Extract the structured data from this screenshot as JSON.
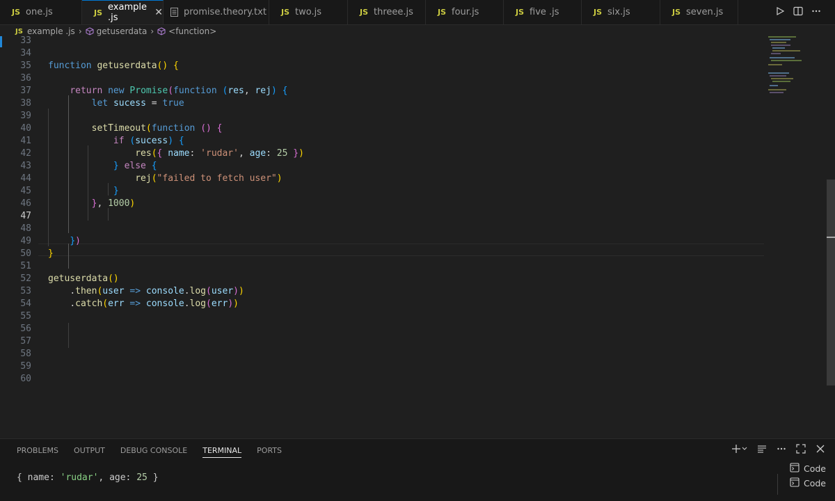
{
  "tabs": [
    {
      "label": "one.js",
      "type": "js",
      "active": false
    },
    {
      "label": "example .js",
      "type": "js",
      "active": true
    },
    {
      "label": "promise.theory.txt",
      "type": "txt",
      "active": false
    },
    {
      "label": "two.js",
      "type": "js",
      "active": false
    },
    {
      "label": "threee.js",
      "type": "js",
      "active": false
    },
    {
      "label": "four.js",
      "type": "js",
      "active": false
    },
    {
      "label": "five .js",
      "type": "js",
      "active": false
    },
    {
      "label": "six.js",
      "type": "js",
      "active": false
    },
    {
      "label": "seven.js",
      "type": "js",
      "active": false
    }
  ],
  "js_icon_text": "JS",
  "close_glyph": "✕",
  "breadcrumb": {
    "file": "example .js",
    "symbol": "getuserdata",
    "child": "<function>"
  },
  "line_numbers": [
    "33",
    "34",
    "35",
    "36",
    "37",
    "38",
    "39",
    "40",
    "41",
    "42",
    "43",
    "44",
    "45",
    "46",
    "47",
    "48",
    "49",
    "50",
    "51",
    "52",
    "53",
    "54",
    "55",
    "56",
    "57",
    "58",
    "59",
    "60"
  ],
  "current_line": "47",
  "panel": {
    "tabs": [
      "PROBLEMS",
      "OUTPUT",
      "DEBUG CONSOLE",
      "TERMINAL",
      "PORTS"
    ],
    "active_tab": "TERMINAL",
    "terminal_output": {
      "open": "{ name: ",
      "name": "'rudar'",
      "mid": ", age: ",
      "age": "25",
      "close": " }"
    },
    "terminal_list": [
      "Code",
      "Code"
    ]
  },
  "colors": {
    "accent": "#0078d4",
    "js_icon": "#cbcb41",
    "keyword": "#569cd6",
    "control": "#c586c0",
    "function": "#dcdcaa",
    "variable": "#9cdcfe",
    "string": "#ce9178",
    "number": "#b5cea8",
    "class": "#4ec9b0"
  }
}
